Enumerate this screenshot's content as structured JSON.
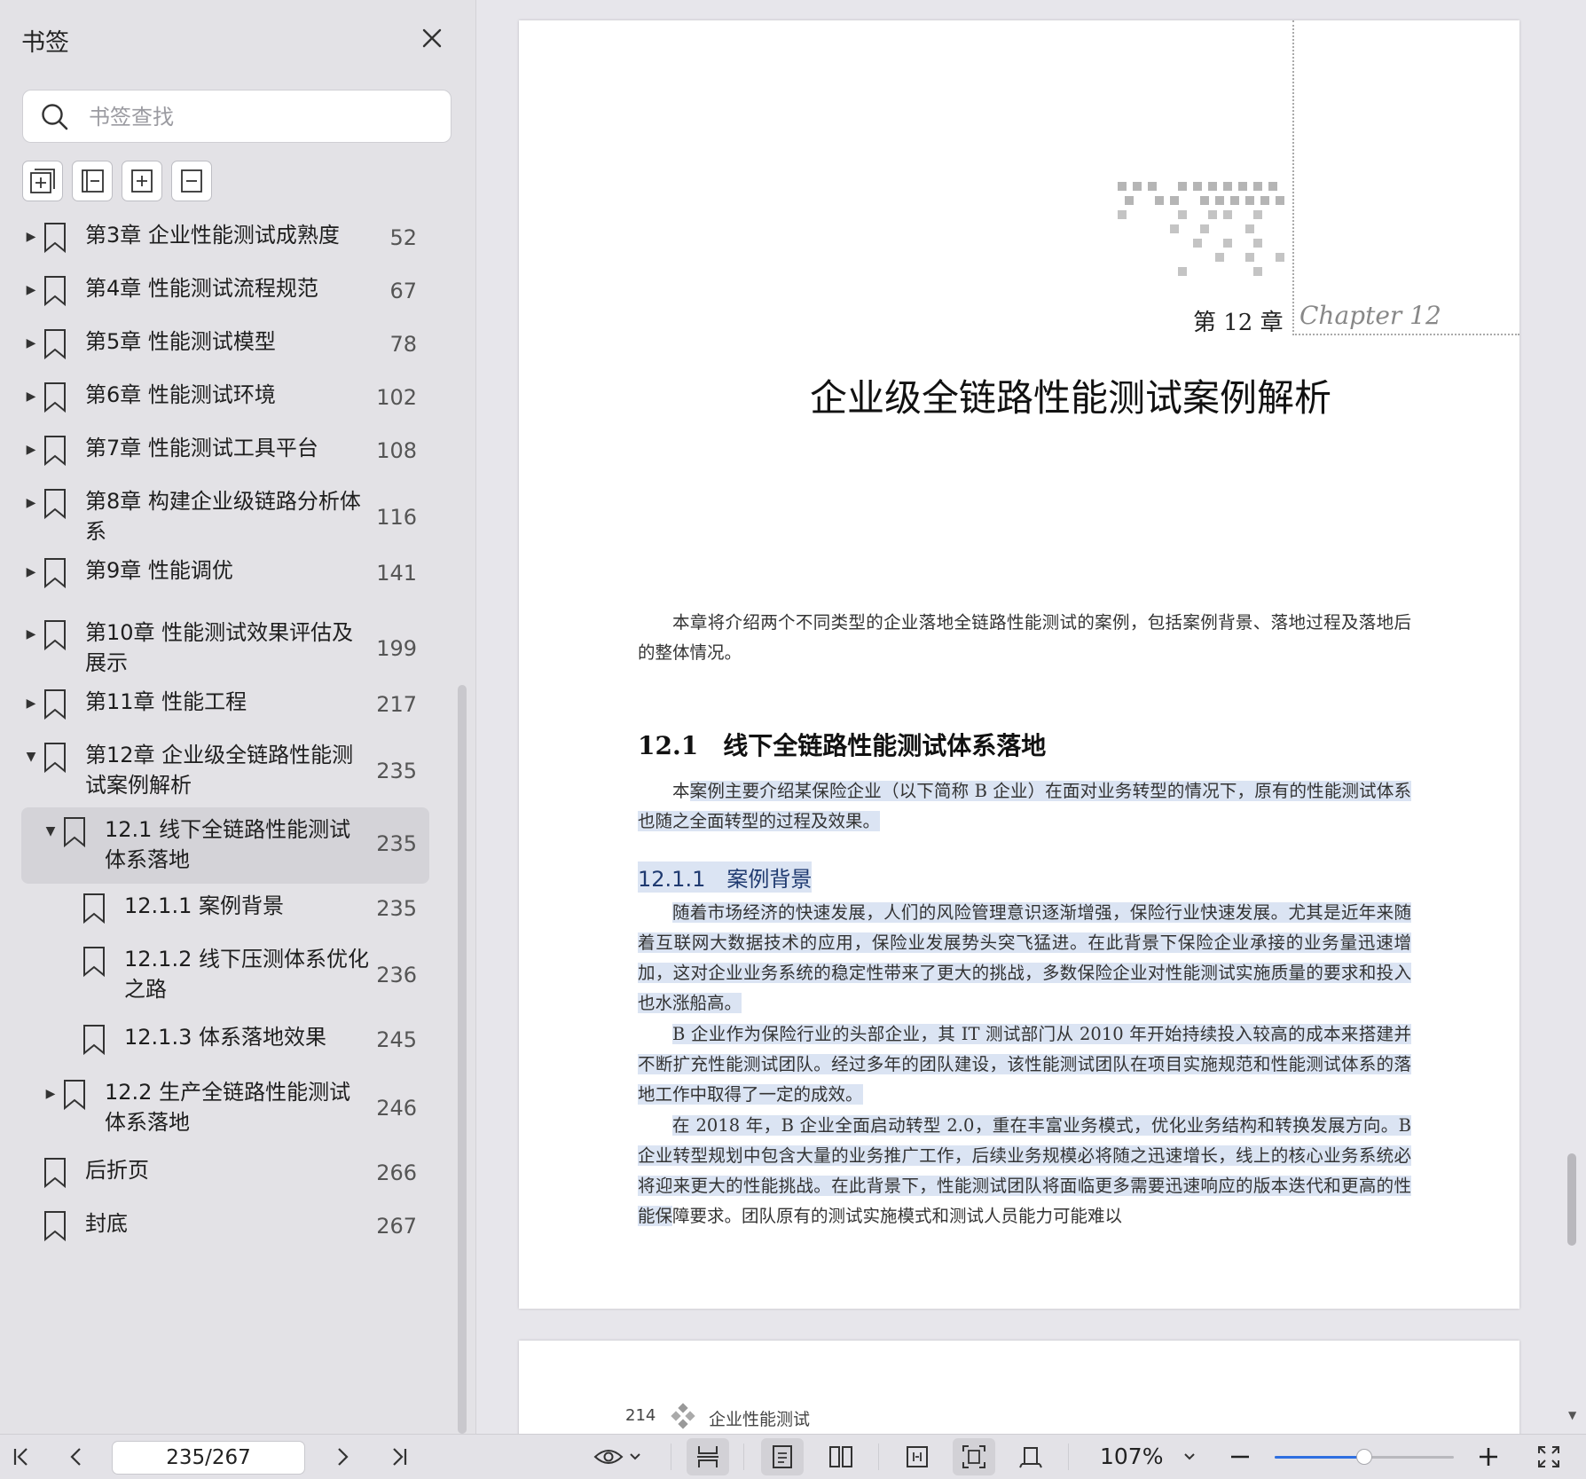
{
  "sidebar": {
    "title": "书签",
    "search": {
      "placeholder": "书签查找",
      "value": ""
    },
    "tool_buttons": [
      "expand-all-icon",
      "collapse-all-icon",
      "add-bookmark-icon",
      "bookmark-current-icon"
    ],
    "bookmarks": [
      {
        "label": "第3章 企业性能测试成熟度",
        "page": "52",
        "level": 0,
        "arrow": "right"
      },
      {
        "label": "第4章 性能测试流程规范",
        "page": "67",
        "level": 0,
        "arrow": "right"
      },
      {
        "label": "第5章 性能测试模型",
        "page": "78",
        "level": 0,
        "arrow": "right"
      },
      {
        "label": "第6章 性能测试环境",
        "page": "102",
        "level": 0,
        "arrow": "right"
      },
      {
        "label": "第7章 性能测试工具平台",
        "page": "108",
        "level": 0,
        "arrow": "right"
      },
      {
        "label": "第8章 构建企业级链路分析体系",
        "page": "116",
        "level": 0,
        "arrow": "right"
      },
      {
        "label": "第9章 性能调优",
        "page": "141",
        "level": 0,
        "arrow": "right"
      },
      {
        "label": "第10章 性能测试效果评估及展示",
        "page": "199",
        "level": 0,
        "arrow": "right"
      },
      {
        "label": "第11章 性能工程",
        "page": "217",
        "level": 0,
        "arrow": "right"
      },
      {
        "label": "第12章 企业级全链路性能测试案例解析",
        "page": "235",
        "level": 0,
        "arrow": "down"
      },
      {
        "label": "12.1 线下全链路性能测试体系落地",
        "page": "235",
        "level": 1,
        "arrow": "down",
        "selected": true
      },
      {
        "label": "12.1.1 案例背景",
        "page": "235",
        "level": 2,
        "arrow": ""
      },
      {
        "label": "12.1.2 线下压测体系优化之路",
        "page": "236",
        "level": 2,
        "arrow": ""
      },
      {
        "label": "12.1.3 体系落地效果",
        "page": "245",
        "level": 2,
        "arrow": ""
      },
      {
        "label": "12.2 生产全链路性能测试体系落地",
        "page": "246",
        "level": 1,
        "arrow": "right"
      },
      {
        "label": "后折页",
        "page": "266",
        "level": 0,
        "arrow": ""
      },
      {
        "label": "封底",
        "page": "267",
        "level": 0,
        "arrow": ""
      }
    ]
  },
  "document": {
    "chapter_number": "第 12 章",
    "chapter_script": "Chapter 12",
    "chapter_title": "企业级全链路性能测试案例解析",
    "intro": "本章将介绍两个不同类型的企业落地全链路性能测试的案例，包括案例背景、落地过程及落地后的整体情况。",
    "section_heading": "12.1　线下全链路性能测试体系落地",
    "section_para_lead": "本",
    "section_para_rest": "案例主要介绍某保险企业（以下简称 B 企业）在面对业务转型的情况下，原有的性能测试体系也随之全面转型的过程及效果。",
    "subsection_heading": "12.1.1　案例背景",
    "bg_para1": "随着市场经济的快速发展，人们的风险管理意识逐渐增强，保险行业快速发展。尤其是近年来随着互联网大数据技术的应用，保险业发展势头突飞猛进。在此背景下保险企业承接的业务量迅速增加，这对企业业务系统的稳定性带来了更大的挑战，多数保险企业对性能测试实施质量的要求和投入也水涨船高。",
    "bg_para2": "B 企业作为保险行业的头部企业，其 IT 测试部门从 2010 年开始持续投入较高的成本来搭建并不断扩充性能测试团队。经过多年的团队建设，该性能测试团队在项目实施规范和性能测试体系的落地工作中取得了一定的成效。",
    "bg_para3_hl": "在 2018 年，B 企业全面启动转型 2.0，重在丰富业务模式，优化业务结构和转换发展方向。B 企业转型规划中包含大量的业务推广工作，后续业务规模必将随之迅速增长，线上的核心业务系统必将迎来更大的性能挑战。在此背景下，性能测试团队将面临更多需要迅速响应的版本迭代和更高的性能保",
    "bg_para3_rest": "障要求。团队原有的测试实施模式和测试人员能力可能难以",
    "footer_page": "214",
    "footer_title": "企业性能测试"
  },
  "toolbar": {
    "page_indicator": "235/267",
    "zoom": "107%",
    "zoom_level": 0.5
  }
}
